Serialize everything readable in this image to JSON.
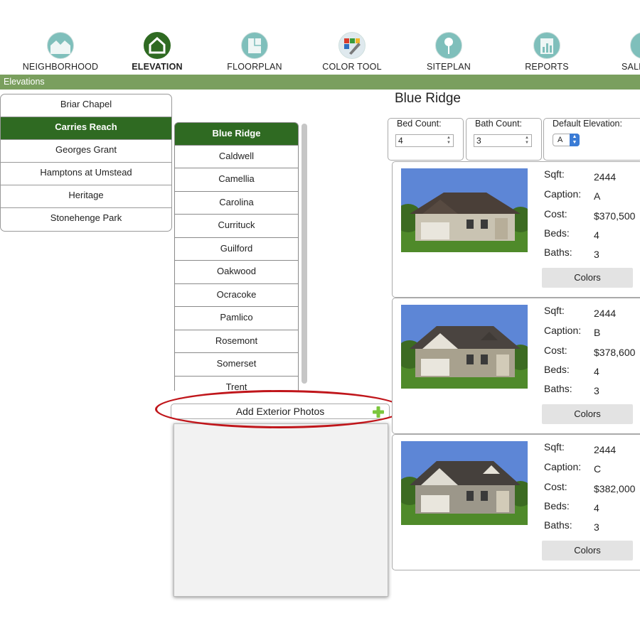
{
  "nav": {
    "items": [
      {
        "label": "NEIGHBORHOOD",
        "icon": "neighborhood-icon"
      },
      {
        "label": "ELEVATION",
        "icon": "house-icon",
        "active": true
      },
      {
        "label": "FLOORPLAN",
        "icon": "floorplan-icon"
      },
      {
        "label": "COLOR TOOL",
        "icon": "color-tool-icon"
      },
      {
        "label": "SITEPLAN",
        "icon": "map-pin-icon"
      },
      {
        "label": "REPORTS",
        "icon": "bar-chart-icon"
      },
      {
        "label": "SALE",
        "icon": "sales-icon"
      }
    ]
  },
  "section_title": "Elevations",
  "neighborhoods": {
    "items": [
      "Briar Chapel",
      "Carries Reach",
      "Georges Grant",
      "Hamptons at Umstead",
      "Heritage",
      "Stonehenge Park"
    ],
    "selected": "Carries Reach"
  },
  "models": {
    "items": [
      "Blue Ridge",
      "Caldwell",
      "Camellia",
      "Carolina",
      "Currituck",
      "Guilford",
      "Oakwood",
      "Ocracoke",
      "Pamlico",
      "Rosemont",
      "Somerset",
      "Trent"
    ],
    "selected": "Blue Ridge"
  },
  "add_photos": {
    "label": "Add Exterior Photos"
  },
  "detail": {
    "title": "Blue Ridge",
    "bed_count": {
      "label": "Bed Count:",
      "value": "4"
    },
    "bath_count": {
      "label": "Bath Count:",
      "value": "3"
    },
    "default_elevation": {
      "label": "Default Elevation:",
      "value": "A"
    },
    "spec_labels": {
      "sqft": "Sqft:",
      "caption": "Caption:",
      "cost": "Cost:",
      "beds": "Beds:",
      "baths": "Baths:"
    },
    "colors_label": "Colors",
    "elevations": [
      {
        "sqft": "2444",
        "caption": "A",
        "cost": "$370,500",
        "beds": "4",
        "baths": "3"
      },
      {
        "sqft": "2444",
        "caption": "B",
        "cost": "$378,600",
        "beds": "4",
        "baths": "3"
      },
      {
        "sqft": "2444",
        "caption": "C",
        "cost": "$382,000",
        "beds": "4",
        "baths": "3"
      }
    ]
  },
  "colors": {
    "accent_green": "#2f6a22",
    "section_bar": "#7a9f5e",
    "nav_icon": "#7fbfbb",
    "highlight_ring": "#c0161b"
  }
}
